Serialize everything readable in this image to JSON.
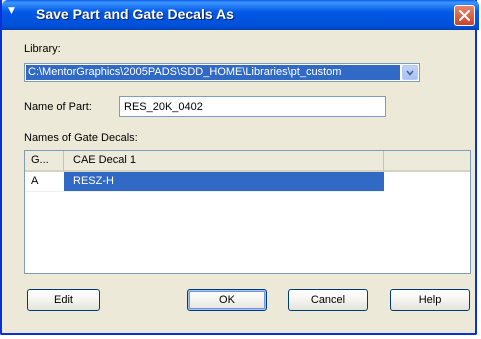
{
  "window": {
    "title": "Save Part and Gate Decals As"
  },
  "library": {
    "label": "Library:",
    "selected": "C:\\MentorGraphics\\2005PADS\\SDD_HOME\\Libraries\\pt_custom"
  },
  "part": {
    "label": "Name of Part:",
    "value": "RES_20K_0402"
  },
  "gate_decals": {
    "label": "Names of Gate Decals:",
    "columns": [
      "G...",
      "CAE Decal 1"
    ],
    "rows": [
      {
        "gate": "A",
        "decal": "RESZ-H"
      }
    ]
  },
  "buttons": {
    "edit": "Edit",
    "ok": "OK",
    "cancel": "Cancel",
    "help": "Help"
  },
  "colors": {
    "titlebar": "#0054e3",
    "selection": "#316ac5",
    "dialog_bg": "#ece9d8"
  },
  "icons": {
    "title": "app-icon",
    "close": "close-icon",
    "dropdown": "chevron-down-icon"
  }
}
